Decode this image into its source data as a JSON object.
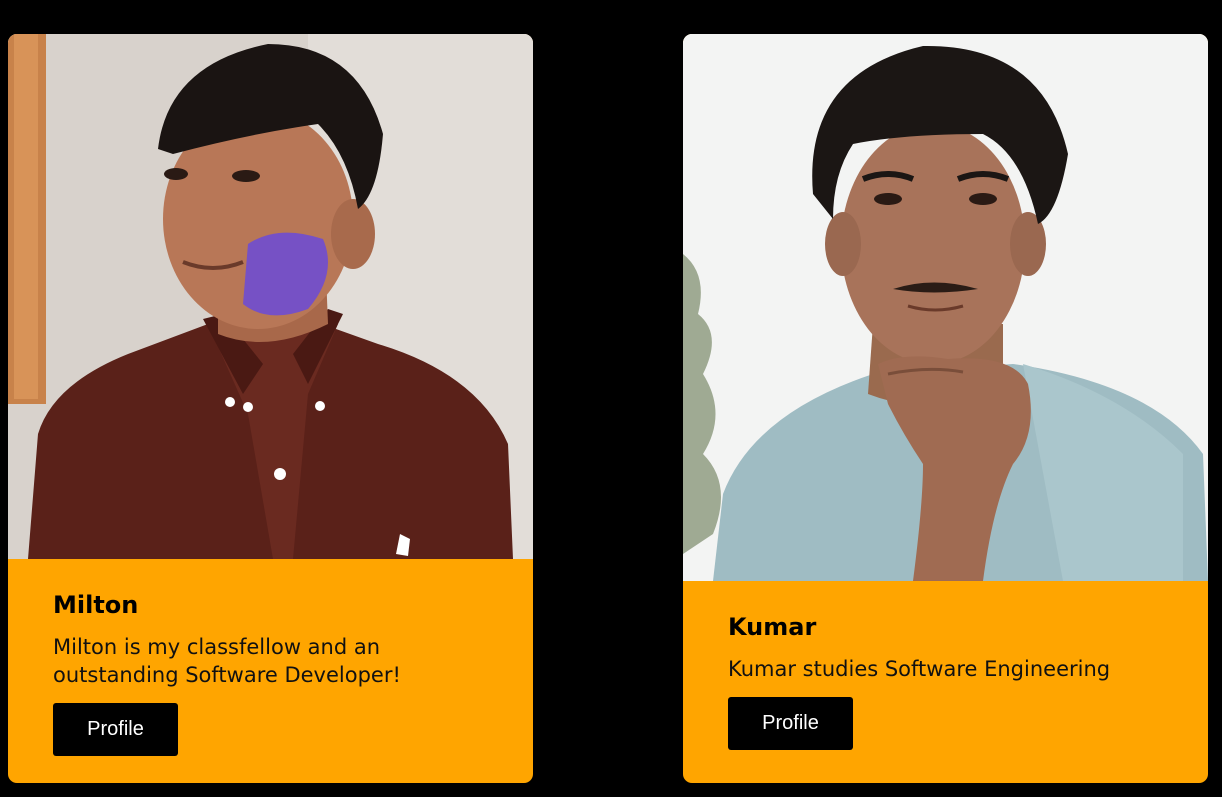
{
  "cards": [
    {
      "name": "Milton",
      "description": "Milton is my classfellow and an outstanding Software Developer!",
      "button_label": "Profile"
    },
    {
      "name": "Kumar",
      "description": "Kumar studies Software Engineering",
      "button_label": "Profile"
    }
  ],
  "colors": {
    "page_background": "#000000",
    "card_background": "#ffa500",
    "button_background": "#000000",
    "button_text": "#ffffff"
  }
}
